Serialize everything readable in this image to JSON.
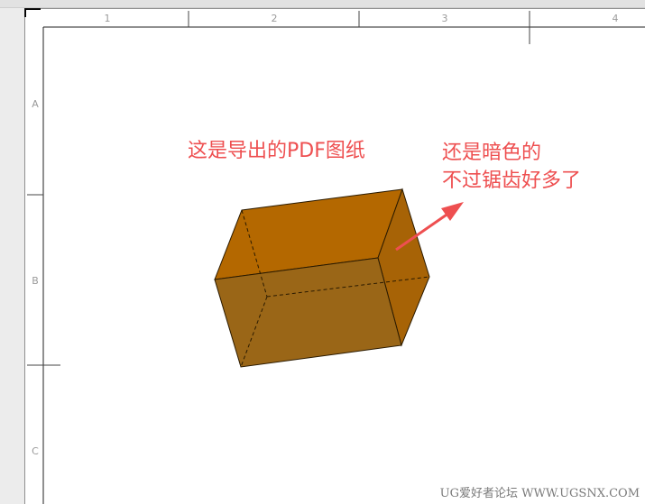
{
  "drawing": {
    "column_zones": [
      "1",
      "2",
      "3",
      "4"
    ],
    "row_zones": [
      "A",
      "B",
      "C"
    ],
    "box_colors": {
      "top": "#b46800",
      "front": "#9a6617",
      "side": "#a76306",
      "edge": "#2a1a00"
    }
  },
  "annotations": {
    "label_left": "这是导出的PDF图纸",
    "label_right_line1": "还是暗色的",
    "label_right_line2": "不过锯齿好多了",
    "color": "#ee4f50"
  },
  "watermark": "UG爱好者论坛 WWW.UGSNX.COM"
}
